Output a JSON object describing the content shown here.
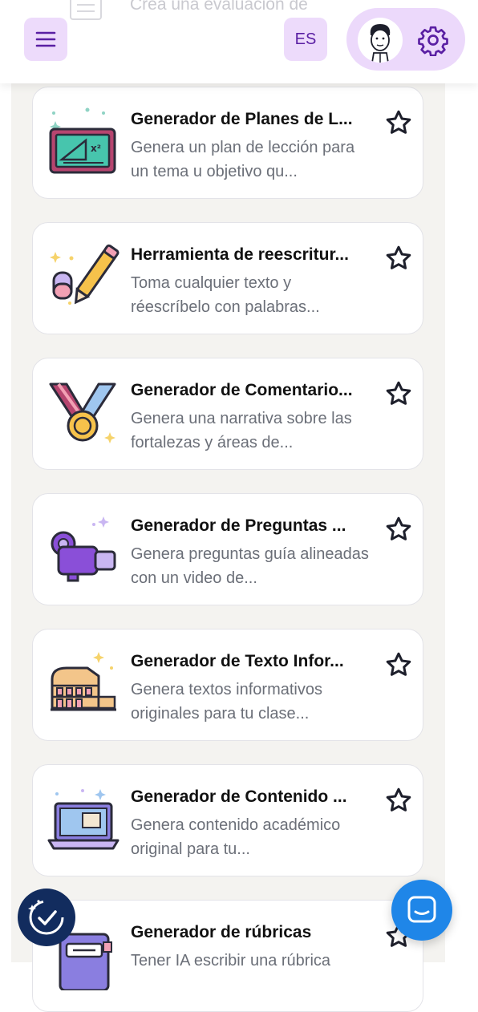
{
  "header": {
    "partial_title": "Crea una evaluación de",
    "language": "ES"
  },
  "cards": [
    {
      "title": "Generador de Planes de L...",
      "description": "Genera un plan de lección para un tema u objetivo qu...",
      "icon": "chalkboard-icon"
    },
    {
      "title": "Herramienta de reescritur...",
      "description": "Toma cualquier texto y réescríbelo con palabras...",
      "icon": "pencil-eraser-icon"
    },
    {
      "title": "Generador de Comentario...",
      "description": "Genera una narrativa sobre las fortalezas y áreas de...",
      "icon": "medal-icon"
    },
    {
      "title": "Generador de Preguntas ...",
      "description": "Genera preguntas guía alineadas con un video de...",
      "icon": "video-camera-icon"
    },
    {
      "title": "Generador de Texto Infor...",
      "description": "Genera textos informativos originales para tu clase...",
      "icon": "colosseum-icon"
    },
    {
      "title": "Generador de Contenido ...",
      "description": "Genera contenido académico original para tu...",
      "icon": "laptop-icon"
    },
    {
      "title": "Generador de rúbricas",
      "description": "Tener IA escribir una rúbrica",
      "icon": "rubric-binder-icon"
    }
  ],
  "colors": {
    "accent_purple": "#5a1fa3",
    "button_bg": "#eddbfb",
    "chat_blue": "#1f86e8",
    "badge_navy": "#122c5e"
  }
}
